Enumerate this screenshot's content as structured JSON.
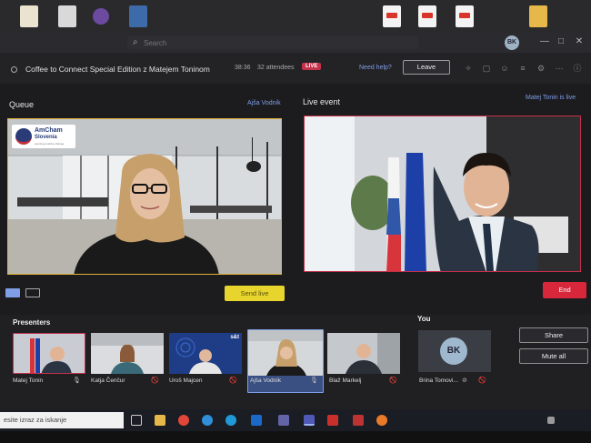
{
  "titlebar": {
    "search_placeholder": "Search",
    "user_initials": "BK",
    "controls": [
      "—",
      "□",
      "✕"
    ]
  },
  "meeting": {
    "title": "Coffee to Connect Special Edition z Matejem Toninom",
    "elapsed": "38:36",
    "attendees": "32 attendees",
    "live_label": "LIVE",
    "help_link": "Need help?",
    "leave_label": "Leave"
  },
  "queue": {
    "label": "Queue",
    "presenter": "Ajša Vodnik",
    "send_live_label": "Send live",
    "logo_line1": "AmCham",
    "logo_line2": "Slovenia",
    "logo_line3": "opening positive change"
  },
  "live_event": {
    "label": "Live event",
    "status": "Matej Tonin is live",
    "end_label": "End"
  },
  "presenters": {
    "label": "Presenters",
    "items": [
      {
        "name": "Matej Tonin"
      },
      {
        "name": "Katja Čenčur"
      },
      {
        "name": "Uroš Majcen"
      },
      {
        "name": "Ajša Vodnik"
      },
      {
        "name": "Blaž Markelj"
      }
    ],
    "tile_badge": "s&t"
  },
  "you": {
    "label": "You",
    "initials": "BK",
    "name": "Brina Tomovi..."
  },
  "side_buttons": {
    "share_label": "Share",
    "mute_all_label": "Mute all"
  },
  "taskbar": {
    "search_text": "esite izraz za iskanje"
  },
  "colors": {
    "accent_live": "#c4314b",
    "queue_border": "#e0b23a",
    "send_live": "#e7d42d",
    "end": "#d8263a",
    "link": "#7f9ee6"
  }
}
